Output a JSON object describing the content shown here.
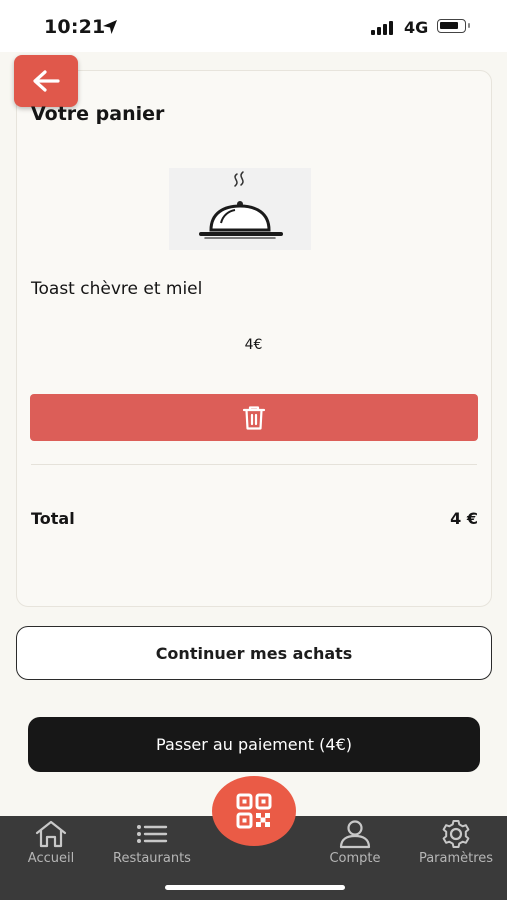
{
  "status_bar": {
    "time": "10:21",
    "network": "4G",
    "battery_level": 0.75
  },
  "cart": {
    "title": "Votre panier",
    "item": {
      "name": "Toast chèvre et miel",
      "price": "4€",
      "image_icon": "cloche-dish-icon"
    },
    "delete_icon": "trash-icon",
    "total_label": "Total",
    "total_value": "4 €"
  },
  "actions": {
    "continue_label": "Continuer mes achats",
    "pay_label": "Passer au paiement (4€)"
  },
  "tab_bar": {
    "items": [
      {
        "label": "Accueil",
        "icon": "home-icon"
      },
      {
        "label": "Restaurants",
        "icon": "list-icon"
      },
      {
        "label": "Compte",
        "icon": "user-icon"
      },
      {
        "label": "Paramètres",
        "icon": "gear-icon"
      }
    ],
    "center_icon": "qr-code-icon"
  },
  "colors": {
    "accent": "#e0584b",
    "delete": "#dc5e58",
    "pay_button": "#171717",
    "tab_bar": "#3a3a3a",
    "background": "#f8f7f2"
  }
}
